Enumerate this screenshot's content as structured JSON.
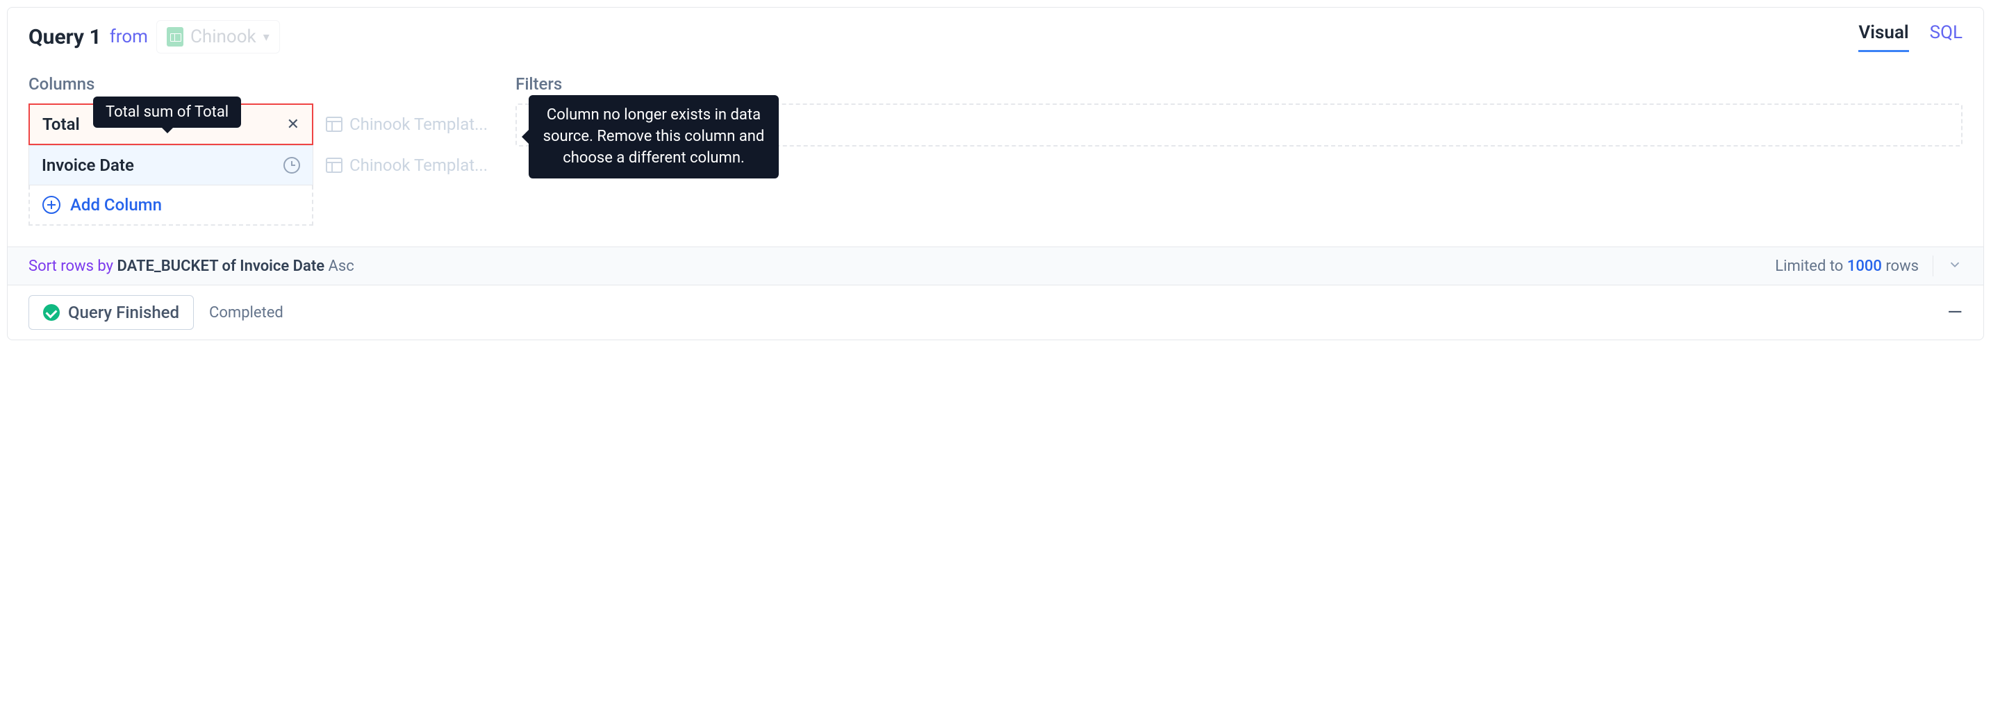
{
  "header": {
    "title": "Query 1",
    "from_label": "from",
    "datasource": "Chinook"
  },
  "tabs": {
    "visual": "Visual",
    "sql": "SQL"
  },
  "columns": {
    "title": "Columns",
    "items": [
      {
        "label": "Total",
        "template": "Chinook Templat...",
        "type": "error"
      },
      {
        "label": "Invoice Date",
        "template": "Chinook Templat...",
        "type": "date"
      }
    ],
    "add_label": "Add Column"
  },
  "filters": {
    "title": "Filters"
  },
  "tooltips": {
    "column": "Total sum of Total",
    "error": "Column no longer exists in data source. Remove this column and choose a different column."
  },
  "sort": {
    "prefix": "Sort rows by",
    "value": "DATE_BUCKET of Invoice Date",
    "direction": "Asc",
    "limit_prefix": "Limited to",
    "limit_count": "1000",
    "limit_suffix": "rows"
  },
  "status": {
    "badge": "Query Finished",
    "text": "Completed"
  }
}
